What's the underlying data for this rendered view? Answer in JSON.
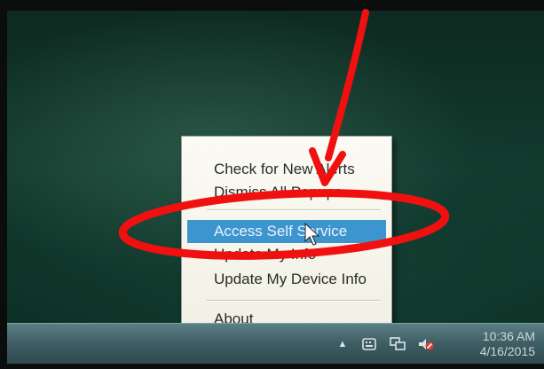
{
  "context_menu": {
    "items": [
      {
        "label": "Check for New Alerts",
        "selected": false
      },
      {
        "label": "Dismiss All Popups",
        "selected": false
      },
      {
        "label": "Access Self Service",
        "selected": true
      },
      {
        "label": "Update My Info",
        "selected": false
      },
      {
        "label": "Update My Device Info",
        "selected": false
      },
      {
        "label": "About",
        "selected": false
      }
    ]
  },
  "taskbar": {
    "tray_icons": [
      "chevron-up-icon",
      "keyboard-icon",
      "network-icon",
      "volume-muted-icon"
    ],
    "clock": {
      "time": "10:36 AM",
      "date": "4/16/2015"
    }
  },
  "colors": {
    "annotation": "#f01010",
    "menu_highlight": "#3d95cf",
    "desktop": "#123a2e",
    "taskbar": "#3e5c63"
  }
}
